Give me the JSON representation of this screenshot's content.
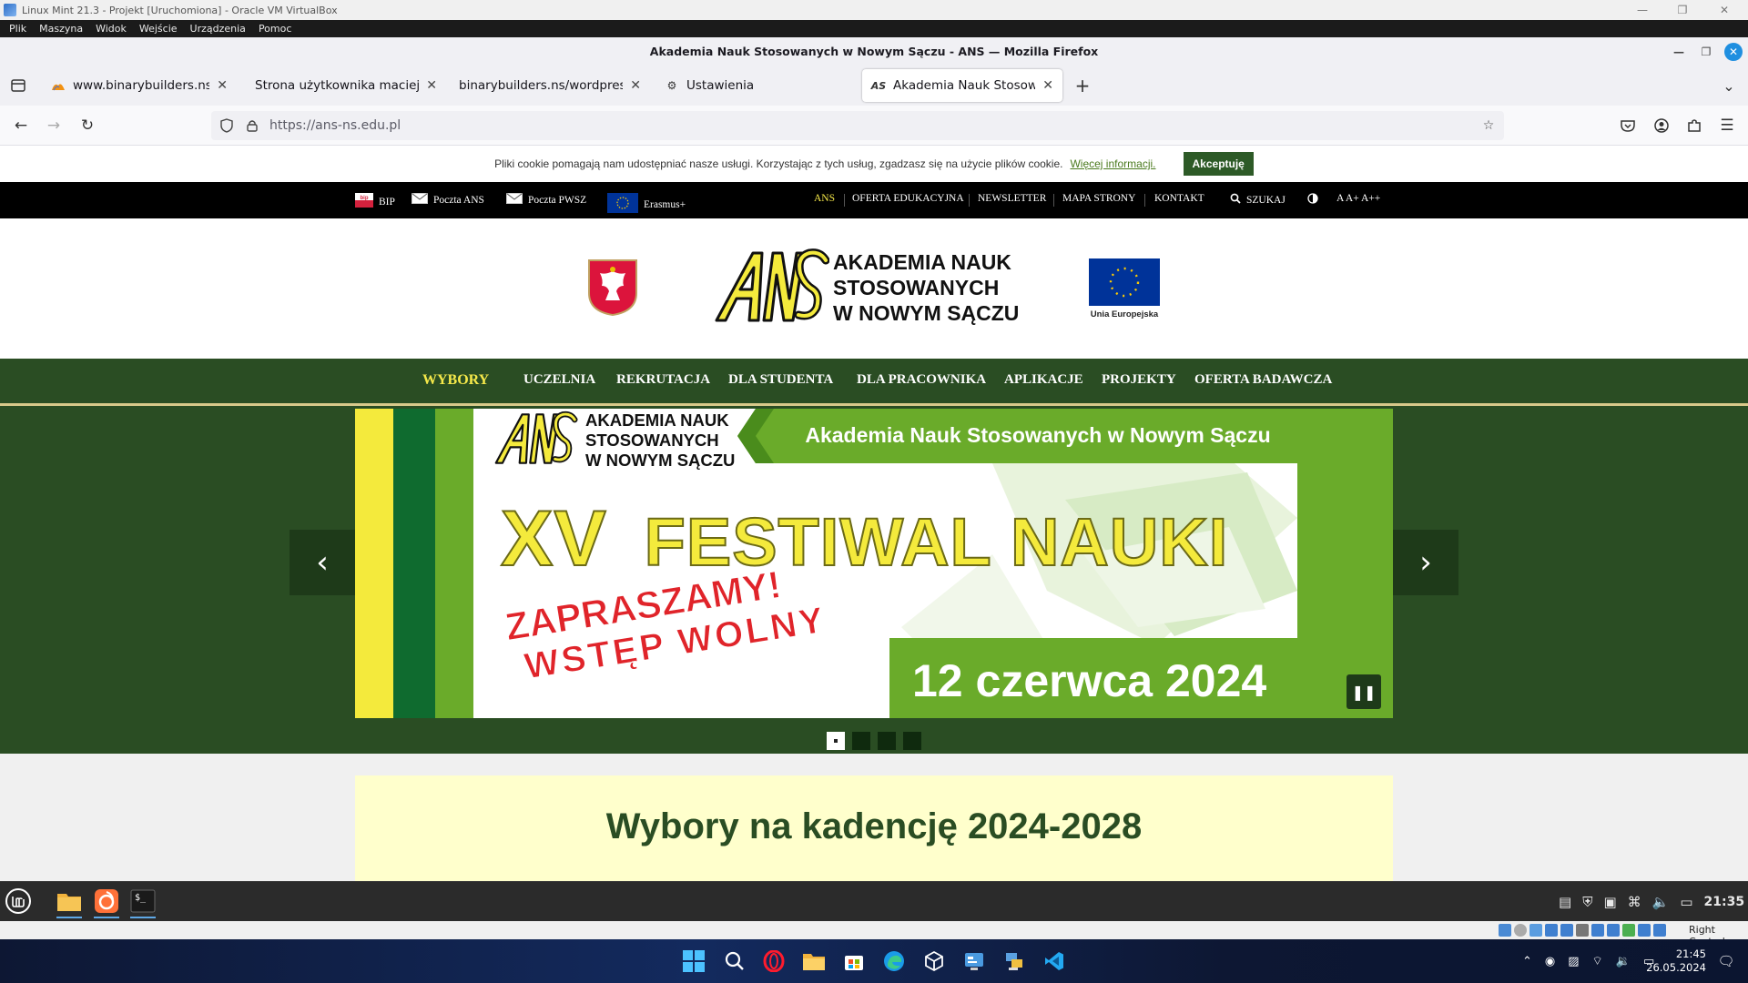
{
  "vbox": {
    "title": "Linux Mint 21.3 - Projekt [Uruchomiona] - Oracle VM VirtualBox",
    "menu": [
      "Plik",
      "Maszyna",
      "Widok",
      "Wejście",
      "Urządzenia",
      "Pomoc"
    ],
    "status_right": "Right Control"
  },
  "firefox": {
    "window_title": "Akademia Nauk Stosowanych w Nowym Sączu - ANS — Mozilla Firefox",
    "tabs": [
      {
        "label": "www.binarybuilders.ns / loc",
        "icon": "phpmyadmin-icon"
      },
      {
        "label": "Strona użytkownika maciej",
        "icon": "none"
      },
      {
        "label": "binarybuilders.ns/wordpress/",
        "icon": "none"
      },
      {
        "label": "Ustawienia",
        "icon": "gear-icon"
      },
      {
        "label": "Akademia Nauk Stosowanych",
        "icon": "ans-icon",
        "active": true
      }
    ],
    "url": "https://ans-ns.edu.pl"
  },
  "site": {
    "cookie": {
      "text": "Pliki cookie pomagają nam udostępniać nasze usługi. Korzystając z tych usług, zgadzasz się na użycie plików cookie.",
      "link": "Więcej informacji.",
      "accept": "Akceptuję"
    },
    "topbar": {
      "left": [
        "BIP",
        "Poczta ANS",
        "Poczta PWSZ",
        "Erasmus+"
      ],
      "right": [
        "ANS",
        "OFERTA EDUKACYJNA",
        "NEWSLETTER",
        "MAPA STRONY",
        "KONTAKT",
        "SZUKAJ"
      ],
      "font_sizes": "A A+ A++"
    },
    "header": {
      "logo_line1": "AKADEMIA NAUK",
      "logo_line2": "STOSOWANYCH",
      "logo_line3": "W NOWYM SĄCZU",
      "eu_label": "Unia Europejska"
    },
    "nav": [
      "WYBORY",
      "UCZELNIA",
      "REKRUTACJA",
      "DLA STUDENTA",
      "DLA PRACOWNIKA",
      "APLIKACJE",
      "PROJEKTY",
      "OFERTA BADAWCZA"
    ],
    "slide": {
      "logo_line1": "AKADEMIA NAUK",
      "logo_line2": "STOSOWANYCH",
      "logo_line3": "W NOWYM SĄCZU",
      "banner": "Akademia Nauk Stosowanych w Nowym Sączu",
      "headline_xv": "XV",
      "headline": "FESTIWAL NAUKI",
      "invite1": "ZAPRASZAMY!",
      "invite2": "WSTĘP WOLNY",
      "date": "12 czerwca 2024"
    },
    "section_title": "Wybory na kadencję 2024-2028"
  },
  "mint_panel": {
    "clock": "21:35"
  },
  "windows": {
    "time": "21:45",
    "date": "26.05.2024"
  },
  "colors": {
    "ans_green": "#2a4d23",
    "ans_yellow": "#f6e94a",
    "slide_green": "#6aab2a",
    "firefox_blue": "#1f8fe0"
  }
}
